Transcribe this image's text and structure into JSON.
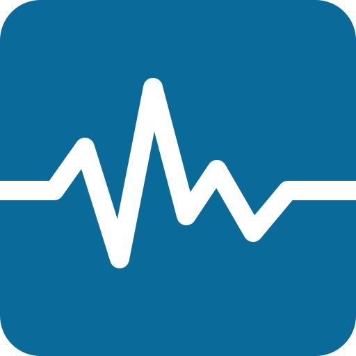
{
  "icon": {
    "name": "pulse-waveform-icon",
    "background_color": "#0a6a9a",
    "stroke_color": "#ffffff"
  }
}
